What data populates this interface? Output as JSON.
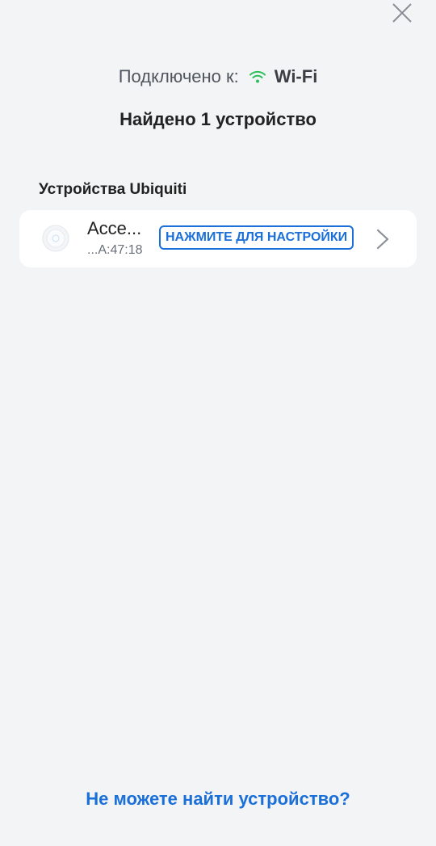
{
  "header": {
    "close_icon": "close-icon"
  },
  "connection": {
    "label": "Подключено к:",
    "network": "Wi-Fi",
    "wifi_icon": "wifi-icon",
    "wifi_color": "#2dbf5a"
  },
  "scan": {
    "result": "Найдено 1 устройство"
  },
  "section": {
    "title": "Устройства Ubiquiti"
  },
  "device": {
    "name": "Acce...",
    "mac": "...A:47:18",
    "setup_label": "НАЖМИТЕ ДЛЯ НАСТРОЙКИ",
    "icon": "access-point-icon",
    "chevron_icon": "chevron-right-icon"
  },
  "footer": {
    "help_link": "Не можете найти устройство?"
  },
  "colors": {
    "accent": "#1a6fd8",
    "background": "#f3f4f6",
    "card": "#ffffff"
  }
}
